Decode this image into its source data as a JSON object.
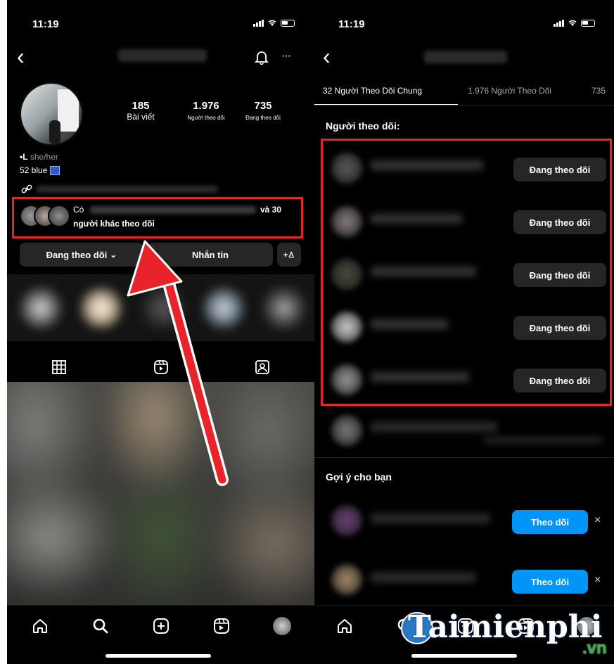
{
  "left": {
    "status": {
      "time": "11:19"
    },
    "header": {
      "back_glyph": "‹",
      "more_glyph": "···"
    },
    "profile": {
      "stats": [
        {
          "num": "185",
          "label": "Bài viết"
        },
        {
          "num": "1.976",
          "label": "Người theo dõi"
        },
        {
          "num": "735",
          "label": "Đang theo dõi"
        }
      ],
      "bio_name_prefix": "•L",
      "pronouns": "she/her",
      "bio_line2": "52 blue"
    },
    "mutual": {
      "prefix": "Có",
      "suffix": "và 30",
      "line2": "người khác theo dõi"
    },
    "buttons": {
      "following": "Đang theo dõi",
      "following_caret": "⌄",
      "message": "Nhắn tin",
      "add_user": "+♙"
    }
  },
  "right": {
    "status": {
      "time": "11:19"
    },
    "header": {
      "back_glyph": "‹"
    },
    "tabs": [
      {
        "label": "32 Người Theo Dõi Chung"
      },
      {
        "label": "1.976 Người Theo Dõi"
      },
      {
        "label": "735"
      }
    ],
    "section_title": "Người theo dõi:",
    "followers": [
      {
        "button": "Đang theo dõi"
      },
      {
        "button": "Đang theo dõi"
      },
      {
        "button": "Đang theo dõi"
      },
      {
        "button": "Đang theo dõi"
      },
      {
        "button": "Đang theo dõi"
      }
    ],
    "suggest_title": "Gợi ý cho bạn",
    "suggestions": [
      {
        "button": "Theo dõi",
        "close": "×"
      },
      {
        "button": "Theo dõi",
        "close": "×"
      }
    ]
  },
  "watermark": {
    "logo": "Taimienphi",
    "tld": ".vn"
  },
  "colors": {
    "highlight": "#e8232a",
    "blue": "#0095f6",
    "dark_button": "#262626",
    "background": "#000000"
  },
  "icons": [
    "back-icon",
    "bell-icon",
    "more-icon",
    "link-icon",
    "verified-icon",
    "add-user-icon",
    "grid-icon",
    "reels-icon",
    "tagged-icon",
    "home-icon",
    "search-icon",
    "new-post-icon",
    "reels-nav-icon",
    "profile-avatar-icon",
    "arrow-icon"
  ]
}
